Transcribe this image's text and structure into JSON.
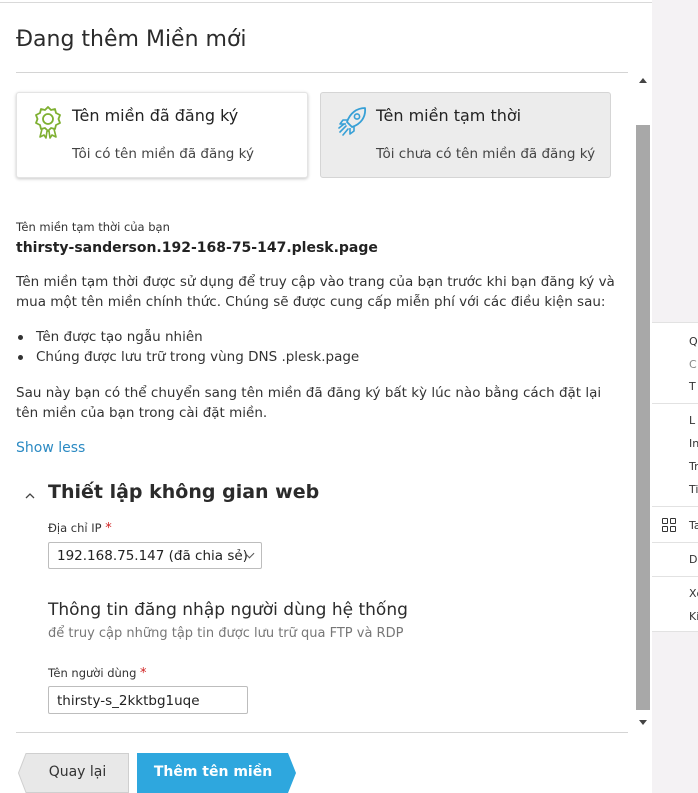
{
  "dialog": {
    "title": "Đang thêm Miền mới",
    "options": [
      {
        "title": "Tên miền đã đăng ký",
        "subtitle": "Tôi có tên miền đã đăng ký",
        "icon": "badge-icon"
      },
      {
        "title": "Tên miền tạm thời",
        "subtitle": "Tôi chưa có tên miền đã đăng ký",
        "icon": "rocket-icon",
        "selected": true
      }
    ],
    "temp_domain_label": "Tên miền tạm thời của bạn",
    "temp_domain_value": "thirsty-sanderson.192-168-75-147.plesk.page",
    "description": "Tên miền tạm thời được sử dụng để truy cập vào trang của bạn trước khi bạn đăng ký và mua một tên miền chính thức. Chúng sẽ được cung cấp miễn phí với các điều kiện sau:",
    "bullets": [
      "Tên được tạo ngẫu nhiên",
      "Chúng được lưu trữ trong vùng DNS .plesk.page"
    ],
    "note": "Sau này bạn có thể chuyển sang tên miền đã đăng ký bất kỳ lúc nào bằng cách đặt lại tên miền của bạn trong cài đặt miền.",
    "show_less": "Show less",
    "section": {
      "title": "Thiết lập không gian web",
      "ip_label": "Địa chỉ IP",
      "required_mark": "*",
      "ip_value": "192.168.75.147 (đã chia sẻ)",
      "login_title": "Thông tin đăng nhập người dùng hệ thống",
      "login_desc": "để truy cập những tập tin được lưu trữ qua FTP và RDP",
      "username_label": "Tên người dùng",
      "username_value": "thirsty-s_2kktbg1uqe"
    },
    "buttons": {
      "back": "Quay lại",
      "add": "Thêm tên miền"
    }
  },
  "background_menu": {
    "items": [
      "Q",
      "C",
      "T",
      "L",
      "In",
      "Tr",
      "Ti",
      "Ta",
      "D",
      "Xo",
      "Ki"
    ]
  },
  "colors": {
    "accent": "#2ea7de",
    "link": "#2b8ac3",
    "icon_green": "#7fb032",
    "icon_blue": "#37a0d6",
    "required": "#d02020"
  }
}
